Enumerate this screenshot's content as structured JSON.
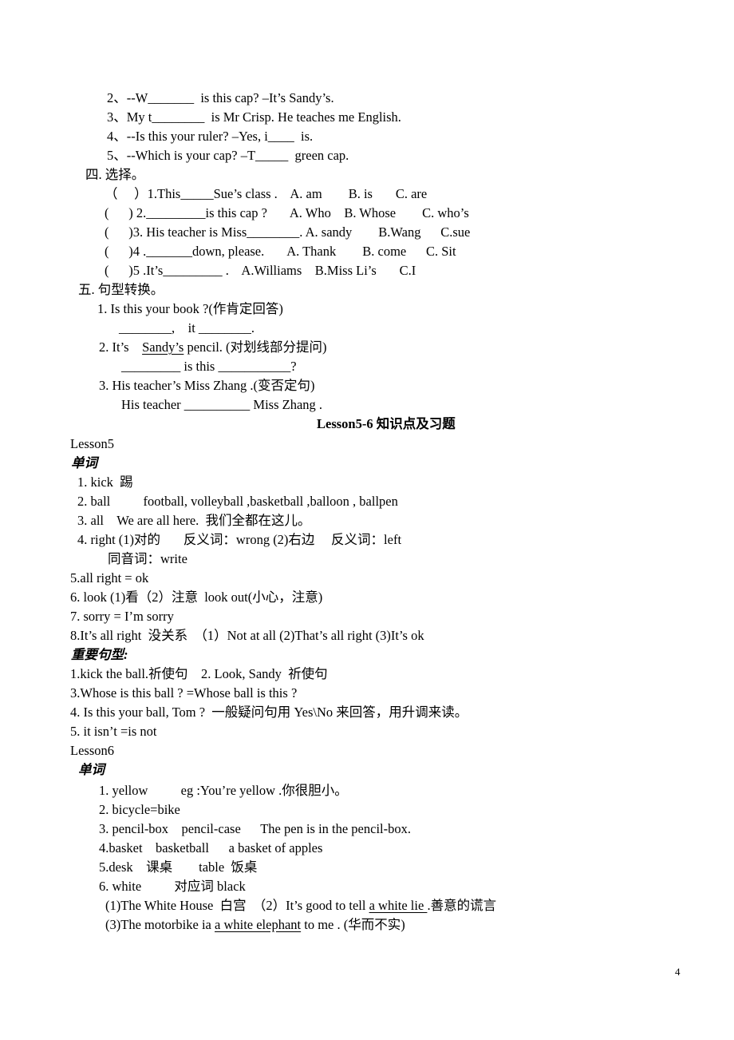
{
  "fill_blanks": [
    "2、--W_______  is this cap? –It’s Sandy’s.",
    "3、My t________  is Mr Crisp. He teaches me English.",
    "4、--Is this your ruler? –Yes, i____  is.",
    "5、--Which is your cap? –T_____  green cap."
  ],
  "section4": {
    "title": "四. 选择。",
    "items": [
      "（     ）1.This_____Sue’s class .    A. am        B. is       C. are",
      "(      ) 2._________is this cap ?       A. Who    B. Whose        C. who’s",
      "(      )3. His teacher is Miss________. A. sandy        B.Wang      C.sue",
      "(      )4 ._______down, please.       A. Thank        B. come      C. Sit",
      "(      )5 .It’s_________ .    A.Williams    B.Miss Li’s       C.I"
    ]
  },
  "section5": {
    "title": "五. 句型转换。",
    "q1": "1. Is this your book ?(作肯定回答)",
    "a1": "________,    it ________.",
    "q2_pre": "2. It’s    ",
    "q2_underlined": "Sandy’s",
    "q2_post": " pencil. (对划线部分提问)",
    "a2": "_________ is this ___________?",
    "q3": "3. His teacher’s Miss Zhang .(变否定句)",
    "a3": "His teacher __________ Miss Zhang ."
  },
  "lesson_heading": "Lesson5-6 知识点及习题",
  "lesson5": {
    "title": "Lesson5",
    "vocab_heading": "单词",
    "vocab": [
      "1. kick  踢",
      "2. ball          football, volleyball ,basketball ,balloon , ballpen",
      "3. all    We are all here.  我们全都在这儿。",
      "4. right (1)对的       反义词：wrong (2)右边     反义词：left",
      "同音词：write",
      "5.all right = ok",
      "6. look (1)看（2）注意  look out(小心，注意)",
      "7. sorry = I’m sorry",
      "8.It’s all right  没关系  （1）Not at all (2)That’s all right (3)It’s ok"
    ],
    "patterns_heading": "重要句型:",
    "patterns": [
      "1.kick the ball.祈使句    2. Look, Sandy  祈使句",
      "3.Whose is this ball ? =Whose ball is this ?",
      "4. Is this your ball, Tom ?  一般疑问句用 Yes\\No 来回答，用升调来读。",
      "5. it isn’t =is not"
    ]
  },
  "lesson6": {
    "title": "Lesson6",
    "vocab_heading": "单词",
    "vocab": [
      "1. yellow          eg :You’re yellow .你很胆小。",
      "2. bicycle=bike",
      "3. pencil-box    pencil-case      The pen is in the pencil-box.",
      "4.basket    basketball      a basket of apples",
      "5.desk    课桌        table  饭桌",
      "6. white          对应词 black"
    ],
    "ex1_pre": "(1)The White House  白宫  （2）It’s good to tell ",
    "ex1_u": "a white lie ",
    "ex1_post": ".善意的谎言",
    "ex2_pre": "(3)The motorbike ia ",
    "ex2_u": "a white elephant",
    "ex2_post": " to me . (华而不实)"
  },
  "page_number": "4"
}
